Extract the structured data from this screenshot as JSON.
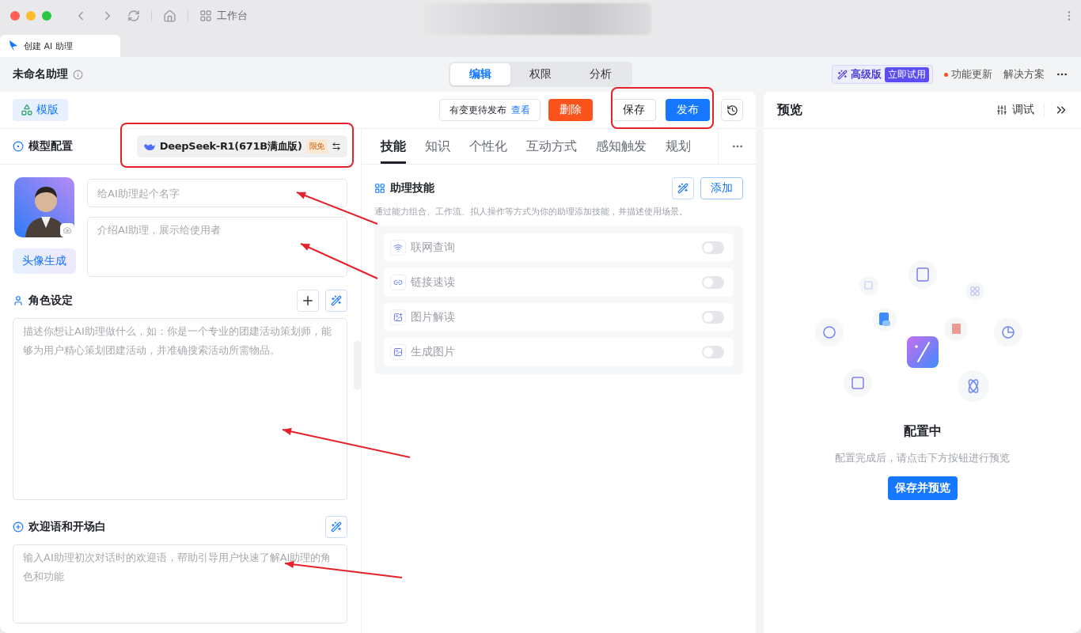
{
  "browser": {
    "nav_label": "工作台",
    "tab_title": "创建 AI 助理"
  },
  "header": {
    "title": "未命名助理",
    "modes": [
      {
        "label": "编辑",
        "selected": true
      },
      {
        "label": "权限",
        "selected": false
      },
      {
        "label": "分析",
        "selected": false
      }
    ],
    "upgrade": {
      "label": "高级版",
      "badge": "立即试用"
    },
    "links": [
      {
        "label": "功能更新",
        "dot": true
      },
      {
        "label": "解决方案",
        "dot": false
      }
    ]
  },
  "toolbar": {
    "template": "模版",
    "notice": "有变更待发布",
    "notice_link": "查看",
    "buttons": [
      {
        "label": "删除",
        "kind": "danger"
      },
      {
        "label": "保存",
        "kind": "default"
      },
      {
        "label": "发布",
        "kind": "primary"
      }
    ]
  },
  "model": {
    "section": "模型配置",
    "name": "DeepSeek-R1(671B满血版)",
    "badge": "限免"
  },
  "profile": {
    "name_placeholder": "给AI助理起个名字",
    "intro_placeholder": "介绍AI助理，展示给使用者",
    "avatar_button": "头像生成"
  },
  "role": {
    "title": "角色设定",
    "placeholder": "描述你想让AI助理做什么，如：你是一个专业的团建活动策划师，能够为用户精心策划团建活动，并准确搜索活动所需物品。"
  },
  "welcome": {
    "title": "欢迎语和开场白",
    "placeholder": "输入AI助理初次对话时的欢迎语，帮助引导用户快速了解AI助理的角色和功能"
  },
  "config_tabs": [
    {
      "label": "技能",
      "selected": true
    },
    {
      "label": "知识",
      "selected": false
    },
    {
      "label": "个性化",
      "selected": false
    },
    {
      "label": "互动方式",
      "selected": false
    },
    {
      "label": "感知触发",
      "selected": false
    },
    {
      "label": "规划",
      "selected": false
    }
  ],
  "skills": {
    "title": "助理技能",
    "add": "添加",
    "description": "通过能力组合、工作流、拟人操作等方式为你的助理添加技能，并描述使用场景。",
    "items": [
      {
        "name": "联网查询",
        "kind": "web",
        "on": false
      },
      {
        "name": "链接速读",
        "kind": "link",
        "on": false
      },
      {
        "name": "图片解读",
        "kind": "image_read",
        "on": false
      },
      {
        "name": "生成图片",
        "kind": "image_gen",
        "on": false
      }
    ]
  },
  "preview": {
    "title": "预览",
    "debug": "调试",
    "status": "配置中",
    "hint": "配置完成后，请点击下方按钮进行预览",
    "button": "保存并预览"
  }
}
